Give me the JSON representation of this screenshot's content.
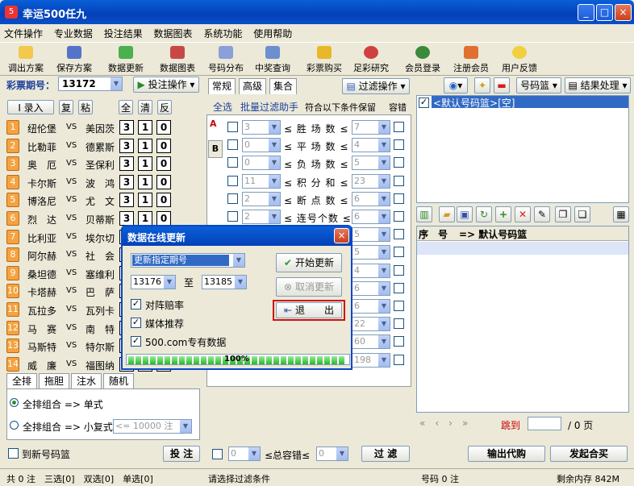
{
  "window": {
    "title": "幸运500任九",
    "min": "_",
    "max": "□",
    "close": "×"
  },
  "menu": [
    "文件操作",
    "专业数据",
    "投注结果",
    "数据图表",
    "系统功能",
    "使用帮助"
  ],
  "toolbar": [
    "调出方案",
    "保存方案",
    "数据更新",
    "数据图表",
    "号码分布",
    "中奖查询",
    "彩票购买",
    "足彩研究",
    "会员登录",
    "注册会员",
    "用户反馈"
  ],
  "left": {
    "issue_label": "彩票期号：",
    "issue_value": "13172",
    "bet_op": "投注操作",
    "buttons": [
      "录入",
      "复",
      "粘",
      "全",
      "清",
      "反"
    ],
    "matches": [
      {
        "n": "1",
        "home": "纽伦堡",
        "vs": "VS",
        "away": "美因茨",
        "v": [
          "3",
          "1",
          "0"
        ]
      },
      {
        "n": "2",
        "home": "比勒菲",
        "vs": "VS",
        "away": "德累斯",
        "v": [
          "3",
          "1",
          "0"
        ]
      },
      {
        "n": "3",
        "home": "奥　厄",
        "vs": "VS",
        "away": "圣保利",
        "v": [
          "3",
          "1",
          "0"
        ]
      },
      {
        "n": "4",
        "home": "卡尔斯",
        "vs": "VS",
        "away": "波　鸿",
        "v": [
          "3",
          "1",
          "0"
        ]
      },
      {
        "n": "5",
        "home": "博洛尼",
        "vs": "VS",
        "away": "尤　文",
        "v": [
          "3",
          "1",
          "0"
        ]
      },
      {
        "n": "6",
        "home": "烈　达",
        "vs": "VS",
        "away": "贝蒂斯",
        "v": [
          "3",
          "1",
          "0"
        ]
      },
      {
        "n": "7",
        "home": "比利亚",
        "vs": "VS",
        "away": "埃尔切",
        "v": [
          "",
          "",
          ""
        ]
      },
      {
        "n": "8",
        "home": "阿尔赫",
        "vs": "VS",
        "away": "社　会",
        "v": [
          "",
          "",
          ""
        ]
      },
      {
        "n": "9",
        "home": "桑坦德",
        "vs": "VS",
        "away": "塞维利",
        "v": [
          "",
          "",
          ""
        ]
      },
      {
        "n": "10",
        "home": "卡塔赫",
        "vs": "VS",
        "away": "巴　萨",
        "v": [
          "",
          "",
          ""
        ]
      },
      {
        "n": "11",
        "home": "瓦拉多",
        "vs": "VS",
        "away": "瓦列卡",
        "v": [
          "",
          "",
          ""
        ]
      },
      {
        "n": "12",
        "home": "马　赛",
        "vs": "VS",
        "away": "南　特",
        "v": [
          "",
          "",
          ""
        ]
      },
      {
        "n": "13",
        "home": "马斯特",
        "vs": "VS",
        "away": "特尔斯",
        "v": [
          "",
          "",
          ""
        ]
      },
      {
        "n": "14",
        "home": "威　廉",
        "vs": "VS",
        "away": "福图纳",
        "v": [
          "",
          "",
          ""
        ]
      }
    ],
    "tabs": [
      "全排",
      "拖胆",
      "注水",
      "随机"
    ],
    "radio1": "全排组合 => 单式",
    "radio2": "全排组合 => 小复式",
    "combo_small": "<= 10000 注",
    "to_basket": "到新号码篮",
    "bet_btn": "投 注"
  },
  "mid": {
    "tabs": [
      "常规",
      "高级",
      "集合"
    ],
    "filter_op": "过滤操作",
    "sel_all": "全选",
    "batch": "批量过滤助手",
    "cond": "符合以下条件保留",
    "tol": "容错",
    "side_a": "A",
    "side_b": "B",
    "rows": [
      {
        "lo": "3",
        "label": "≤ 胜 场 数 ≤",
        "hi": "7"
      },
      {
        "lo": "0",
        "label": "≤ 平 场 数 ≤",
        "hi": "4"
      },
      {
        "lo": "0",
        "label": "≤ 负 场 数 ≤",
        "hi": "5"
      },
      {
        "lo": "11",
        "label": "≤ 积 分 和 ≤",
        "hi": "23"
      },
      {
        "lo": "2",
        "label": "≤ 断 点 数 ≤",
        "hi": "6"
      },
      {
        "lo": "2",
        "label": "≤ 连号个数 ≤",
        "hi": "6"
      },
      {
        "lo": "",
        "label": "",
        "hi": "5"
      },
      {
        "lo": "",
        "label": "",
        "hi": "5"
      },
      {
        "lo": "",
        "label": "",
        "hi": "4"
      },
      {
        "lo": "",
        "label": "",
        "hi": "6"
      },
      {
        "lo": "",
        "label": "",
        "hi": "6"
      },
      {
        "lo": "",
        "label": "",
        "hi": "22"
      },
      {
        "lo": "",
        "label": "",
        "hi": "60"
      },
      {
        "lo": "48",
        "label": "≤号码位积和≤",
        "hi": "198"
      }
    ],
    "tol_lo": "0",
    "tol_label": "≤总容错≤",
    "tol_hi": "0",
    "filter_btn": "过 滤"
  },
  "right": {
    "basket_btn": "号码篮",
    "result_btn": "结果处理",
    "basket_item": "<默认号码篮>[空]",
    "col1": "序　号",
    "col2": "=> 默认号码篮",
    "jump": "跳到",
    "pages": "/ 0 页",
    "btn1": "输出代购",
    "btn2": "发起合买"
  },
  "dialog": {
    "title": "数据在线更新",
    "mode": "更新指定期号",
    "from": "13176",
    "to_label": "至",
    "to": "13185",
    "chk1": "对阵赔率",
    "chk2": "媒体推荐",
    "chk3": "500.com专有数据",
    "start": "开始更新",
    "cancel": "取消更新",
    "exit": "退　　出",
    "progress": "100%"
  },
  "status": {
    "left": "共 0 注　三选[0]　双选[0]　单选[0]",
    "mid": "请选择过滤条件",
    "code": "号码 0 注",
    "mem": "剩余内存 842M"
  }
}
